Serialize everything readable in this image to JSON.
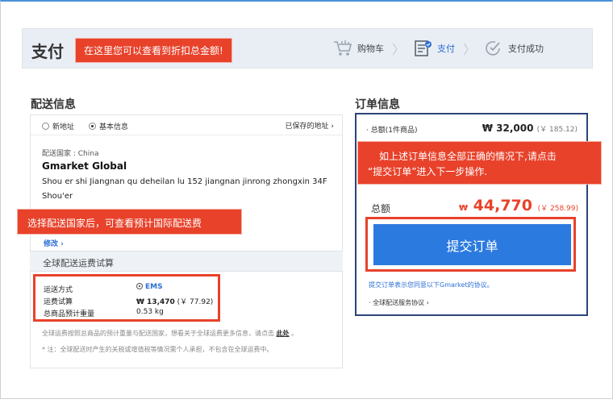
{
  "header": {
    "title": "支付",
    "callout": "在这里您可以查看到折扣总金额!",
    "steps": [
      {
        "label": "购物车",
        "icon": "cart-icon"
      },
      {
        "label": "支付",
        "icon": "checklist-icon"
      },
      {
        "label": "支付成功",
        "icon": "check-circle-icon"
      }
    ],
    "separator": "〉"
  },
  "delivery": {
    "section_title": "配送信息",
    "option_new": "新地址",
    "option_basic": "基本信息",
    "saved_link": "已保存的地址 ›",
    "country": "配送国家 : China",
    "name": "Gmarket Global",
    "address_line1": "Shou er shi Jiangnan qu deheilan lu 152 jiangnan jinrong zhongxin 34F",
    "address_line2": "Shou'er",
    "callout": "选择配送国家后，可查看预计国际配送费",
    "modify_link": "修改 ›"
  },
  "shipping_calc": {
    "title": "全球配送运费试算",
    "method_label": "运送方式",
    "method_value": "EMS",
    "fee_label": "运费试算",
    "fee_value": "₩ 13,470",
    "fee_cny": "(￥ 77.92)",
    "weight_label": "总商品预计重量",
    "weight_value": "0.53 kg",
    "note1": "全球运费按照总商品的预计重量与配送国家，想看关于全球运费更多信息，请点击",
    "note1_link": "此处",
    "note1_end": "。",
    "note2": "* 注：全球配送时产生的关税或增值税等情况需个人承担，不包含在全球运费中。"
  },
  "order": {
    "section_title": "订单信息",
    "total_label": "· 总额(1件商品)",
    "total_value": "₩ 32,000",
    "total_cny": "(￥ 185.12)",
    "callout_line1": "如上述订单信息全部正确的情况下,请点击",
    "callout_line2": "“提交订单”进入下一步操作.",
    "grand_label": "总额",
    "grand_currency": "₩",
    "grand_value": "44,770",
    "grand_cny": "(￥ 258.99)",
    "submit_label": "提交订单",
    "agree_text": "提交订单表示您同意以下Gmarket的协议。",
    "shipping_agreement": "· 全球配送服务协议 ›"
  },
  "colors": {
    "accent_red": "#e8422b",
    "primary_blue": "#2b7ae0",
    "order_border": "#2b4478"
  }
}
